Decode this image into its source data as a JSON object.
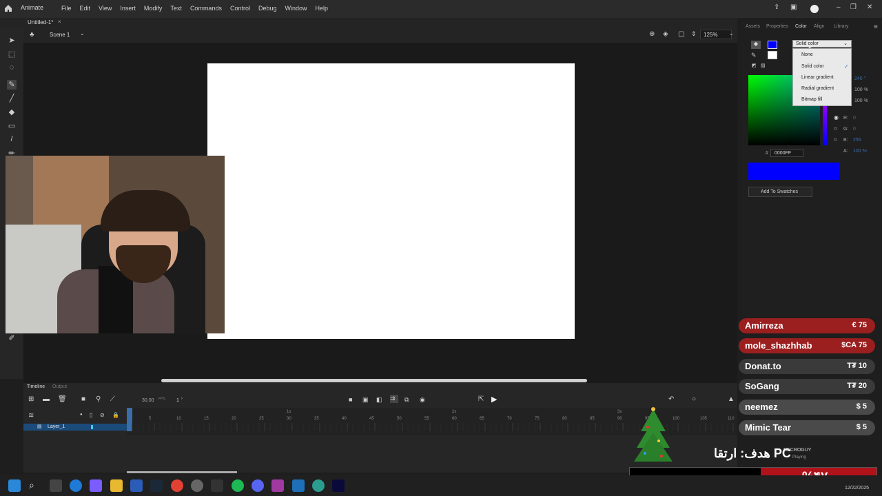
{
  "app": {
    "name": "Animate",
    "document_tab": "Untitled-1*",
    "scene": "Scene 1",
    "zoom": "125%"
  },
  "menu": [
    "File",
    "Edit",
    "View",
    "Insert",
    "Modify",
    "Text",
    "Commands",
    "Control",
    "Debug",
    "Window",
    "Help"
  ],
  "panel_tabs": [
    "Assets",
    "Properties",
    "Color",
    "Align",
    "Library"
  ],
  "color_panel": {
    "fill_type": "Solid color",
    "fill_options": [
      "None",
      "Solid color",
      "Linear gradient",
      "Radial gradient",
      "Bitmap fill"
    ],
    "selected_option": "Solid color",
    "hex_label": "#",
    "hex": "0000FF",
    "hue": "240 °",
    "sat": "100 %",
    "bright": "100 %",
    "r": "0",
    "g": "0",
    "b": "255",
    "alpha": "100 %",
    "r_label": "R:",
    "g_label": "G:",
    "b_label": "B:",
    "a_label": "A:",
    "add_swatches": "Add To Swatches",
    "swatch_color": "#0000ff"
  },
  "timeline": {
    "tabs": [
      "Timeline",
      "Output"
    ],
    "fps": "30.00",
    "fps_unit": "FPS",
    "frame": "1",
    "frame_unit": "F",
    "layer": "Layer_1",
    "ruler": [
      "5",
      "10",
      "15",
      "20",
      "25",
      "30",
      "35",
      "40",
      "45",
      "50",
      "55",
      "60",
      "65",
      "70",
      "75",
      "80",
      "85",
      "90",
      "95",
      "100",
      "105",
      "110"
    ],
    "seconds": [
      "1s",
      "2s",
      "3s"
    ]
  },
  "donations": [
    {
      "name": "Amirreza",
      "amount": "€ 75",
      "color": "#9b1f1f"
    },
    {
      "name": "mole_shazhhab",
      "amount": "$CA 75",
      "color": "#9b1f1f"
    },
    {
      "name": "Donat.to",
      "amount": "T₮ 10",
      "color": "#3a3a3a"
    },
    {
      "name": "SoGang",
      "amount": "T₮ 20",
      "color": "#3a3a3a"
    },
    {
      "name": "neemez",
      "amount": "$ 5",
      "color": "#4a4a4a"
    },
    {
      "name": "Mimic Tear",
      "amount": "$ 5",
      "color": "#4a4a4a"
    }
  ],
  "overlay": {
    "goal_text": "هدف: ارتقا PC",
    "percent": "%۴۷",
    "viewer": "NECROGUY",
    "viewer_status": "Playing"
  },
  "taskbar": {
    "date": "12/22/2025"
  }
}
